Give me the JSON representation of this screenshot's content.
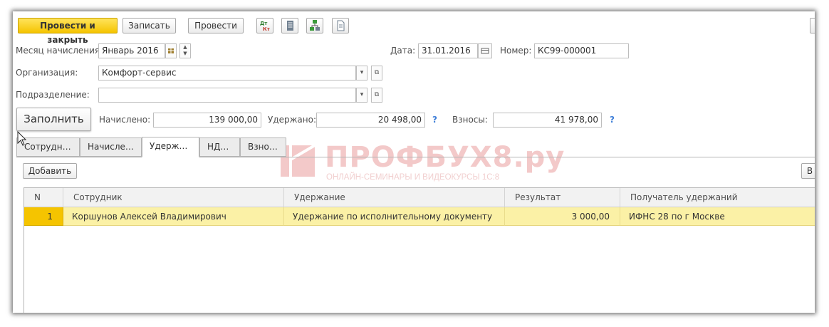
{
  "toolbar": {
    "post_close_label": "Провести и закрыть",
    "save_label": "Записать",
    "post_label": "Провести",
    "dt_kt_icon": "Дт\nКт"
  },
  "header": {
    "month_label": "Месяц начисления:",
    "month_value": "Январь 2016",
    "date_label": "Дата:",
    "date_value": "31.01.2016",
    "number_label": "Номер:",
    "number_value": "КС99-000001",
    "org_label": "Организация:",
    "org_value": "Комфорт-сервис",
    "dept_label": "Подразделение:",
    "dept_value": ""
  },
  "totals": {
    "fill_label": "Заполнить",
    "accrued_label": "Начислено:",
    "accrued_value": "139 000,00",
    "withheld_label": "Удержано:",
    "withheld_value": "20 498,00",
    "contrib_label": "Взносы:",
    "contrib_value": "41 978,00",
    "help": "?"
  },
  "tabs": [
    {
      "label": "Сотрудни..."
    },
    {
      "label": "Начислен..."
    },
    {
      "label": "Удержан..."
    },
    {
      "label": "НДФЛ"
    },
    {
      "label": "Взносы"
    }
  ],
  "grid": {
    "add_label": "Добавить",
    "right_btn_label": "В",
    "columns": [
      "N",
      "Сотрудник",
      "Удержание",
      "Результат",
      "Получатель удержаний"
    ],
    "rows": [
      {
        "n": "1",
        "employee": "Коршунов Алексей Владимирович",
        "deduction": "Удержание по исполнительному документу",
        "result": "3 000,00",
        "recipient": "ИФНС 28 по г Москве"
      }
    ]
  },
  "watermark": {
    "title": "ПРОФБУХ8.ру",
    "subtitle": "ОНЛАЙН-СЕМИНАРЫ И ВИДЕОКУРСЫ 1С:8"
  },
  "colors": {
    "primary": "#f5c400",
    "row_highlight": "#fbf1a6",
    "help": "#3f7fd8",
    "watermark": "#f3c9c9"
  }
}
